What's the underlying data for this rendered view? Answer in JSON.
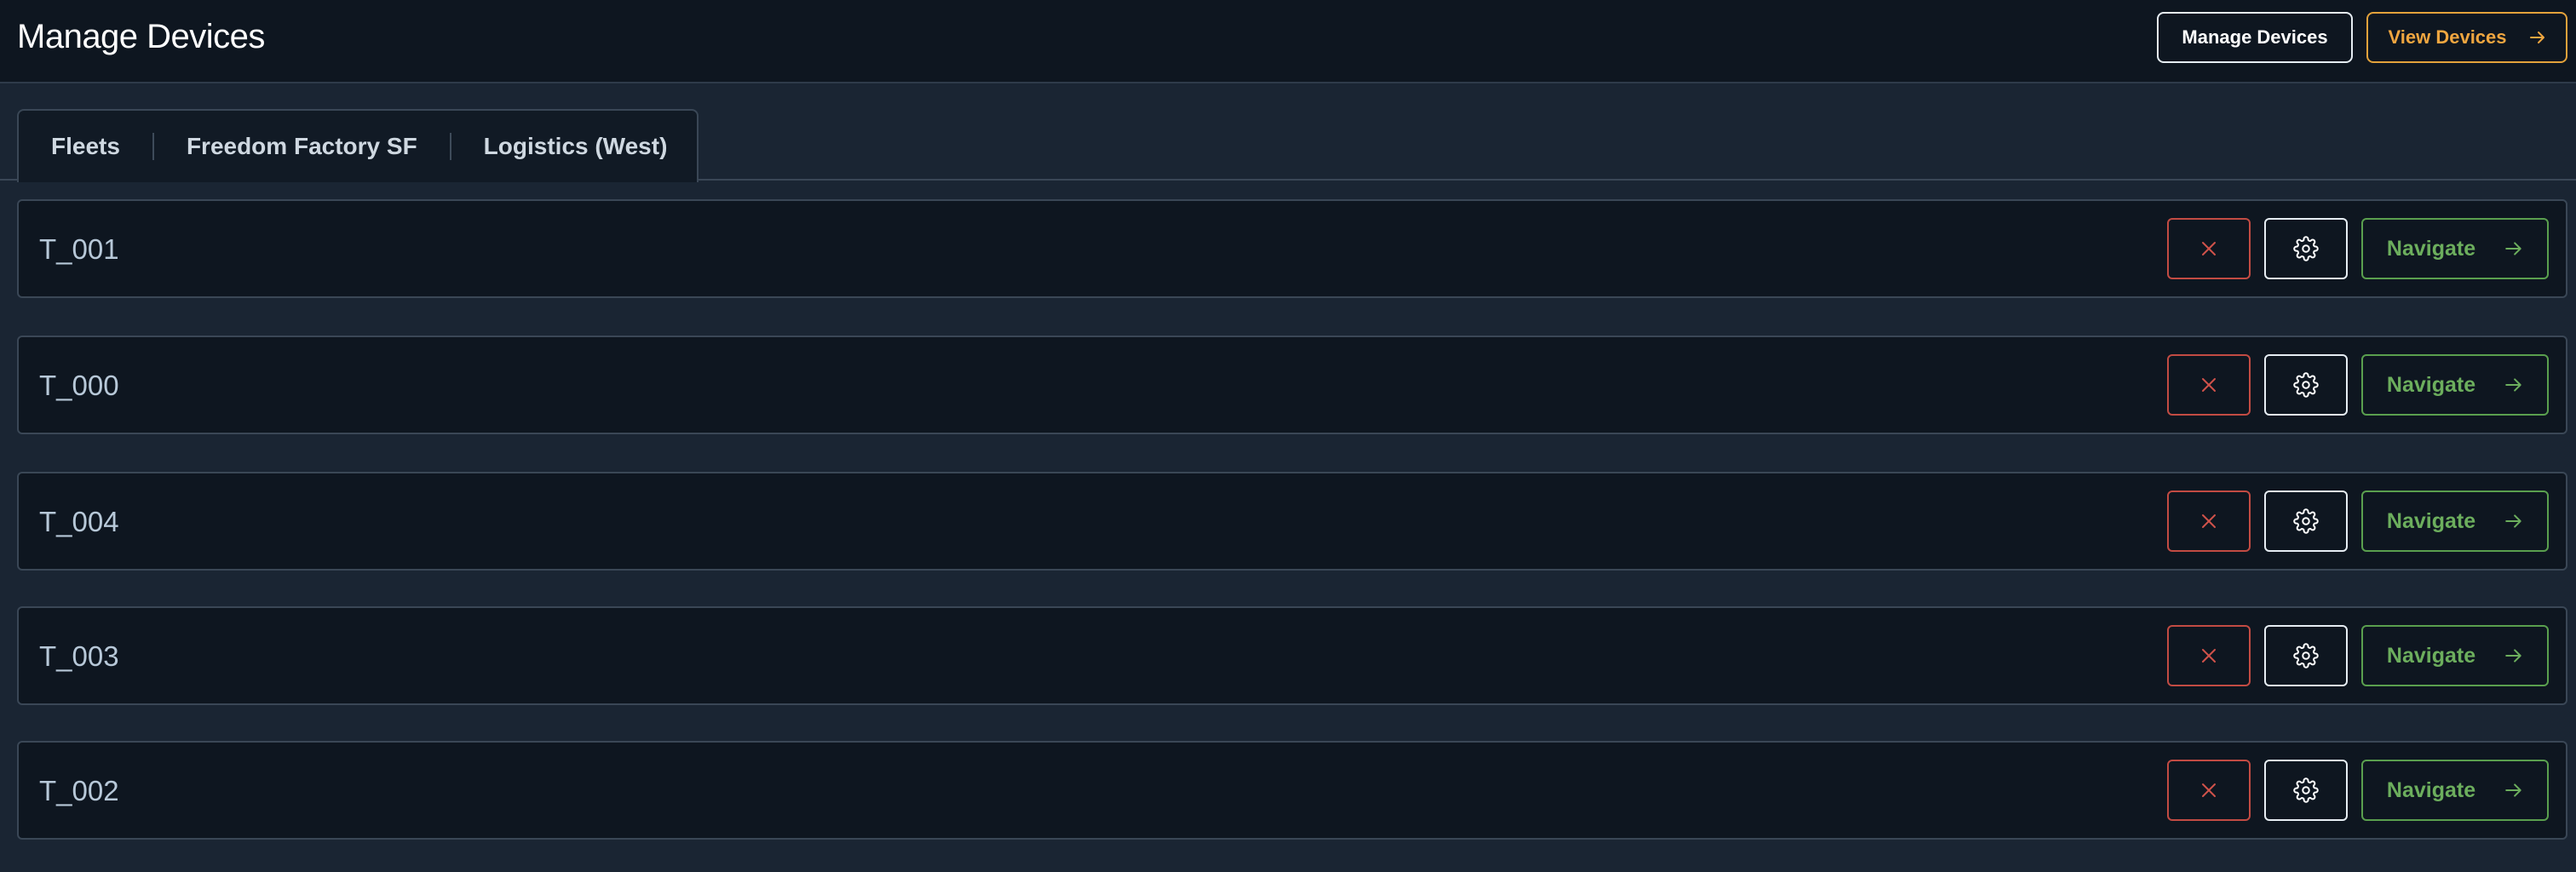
{
  "header": {
    "title": "Manage Devices",
    "manage_button": "Manage Devices",
    "view_button": "View Devices"
  },
  "tabs": [
    {
      "label": "Fleets"
    },
    {
      "label": "Freedom Factory SF"
    },
    {
      "label": "Logistics (West)"
    }
  ],
  "devices": [
    {
      "name": "T_001",
      "navigate_label": "Navigate"
    },
    {
      "name": "T_000",
      "navigate_label": "Navigate"
    },
    {
      "name": "T_004",
      "navigate_label": "Navigate"
    },
    {
      "name": "T_003",
      "navigate_label": "Navigate"
    },
    {
      "name": "T_002",
      "navigate_label": "Navigate"
    }
  ],
  "colors": {
    "background": "#1a2533",
    "header_background": "#0e1620",
    "delete": "#c24b43",
    "navigate": "#5a9f4e",
    "view_accent": "#e3a23b"
  },
  "icons": {
    "delete": "close-icon",
    "settings": "gear-icon",
    "navigate": "arrow-right-icon"
  }
}
